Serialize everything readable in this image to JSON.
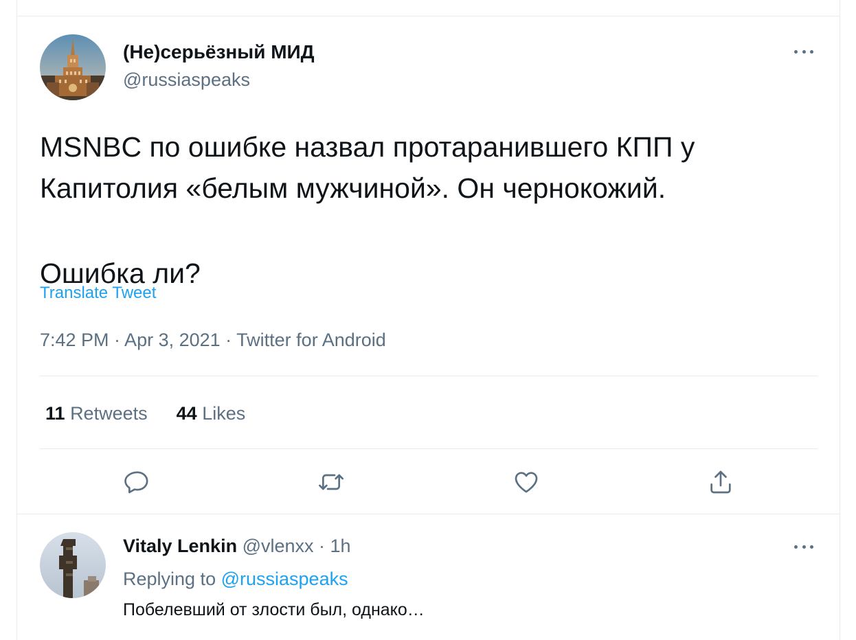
{
  "tweet": {
    "display_name": "(Не)серьёзный МИД",
    "handle": "@russiaspeaks",
    "text_line_1": "MSNBC по ошибке назвал протаранившего КПП у",
    "text_line_2": "Капитолия «белым мужчиной». Он чернокожий.",
    "text_line_3": "Ошибка ли?",
    "translate_label": "Translate Tweet",
    "timestamp": "7:42 PM · Apr 3, 2021 · Twitter for Android",
    "retweets_count": "11",
    "retweets_label": "Retweets",
    "likes_count": "44",
    "likes_label": "Likes"
  },
  "reply": {
    "display_name": "Vitaly Lenkin",
    "meta": "@vlenxx · 1h",
    "replying_prefix": "Replying to",
    "replying_to": "@russiaspeaks",
    "text": "Побелевший от злости был, однако…"
  },
  "icons": {
    "more": "more-horizontal-icon",
    "reply": "reply-icon",
    "retweet": "retweet-icon",
    "like": "heart-icon",
    "share": "share-icon"
  },
  "colors": {
    "text_primary": "#0f1419",
    "text_secondary": "#5b7083",
    "link": "#1da1f2",
    "divider": "#e6ecf0"
  }
}
